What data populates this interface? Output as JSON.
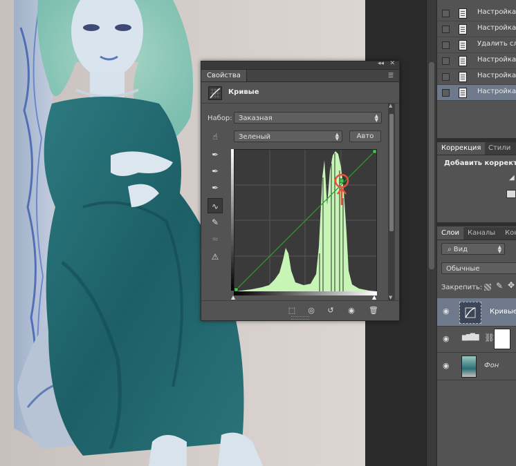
{
  "history": {
    "items": [
      {
        "label": "Настройка c",
        "selected": false
      },
      {
        "label": "Настройка c",
        "selected": false
      },
      {
        "label": "Удалить сле",
        "selected": false
      },
      {
        "label": "Настройка c",
        "selected": false
      },
      {
        "label": "Настройка c",
        "selected": false
      },
      {
        "label": "Настройка c",
        "selected": true
      }
    ]
  },
  "adjustments": {
    "tabs": [
      "Коррекция",
      "Стили"
    ],
    "add_text": "Добавить корректир"
  },
  "layers_panel": {
    "tabs": [
      "Слои",
      "Каналы",
      "Кон"
    ],
    "filter_label": "Вид",
    "blend_mode": "Обычные",
    "lock_label": "Закрепить:",
    "layers": [
      {
        "name": "Кривые",
        "selected": true
      },
      {
        "name": "",
        "selected": false
      },
      {
        "name": "Фон",
        "selected": false
      }
    ]
  },
  "properties": {
    "tab_label": "Свойства",
    "title": "Кривые",
    "preset_label": "Набор:",
    "preset_value": "Заказная",
    "channel_value": "Зеленый",
    "auto_button": "Авто",
    "curve_points_input": [
      0,
      255
    ],
    "curve_points_output": [
      0,
      255
    ],
    "colors": {
      "curve": "#2f9d2f",
      "histogram": "#c6f5b6",
      "marker": "#e5533d"
    }
  }
}
